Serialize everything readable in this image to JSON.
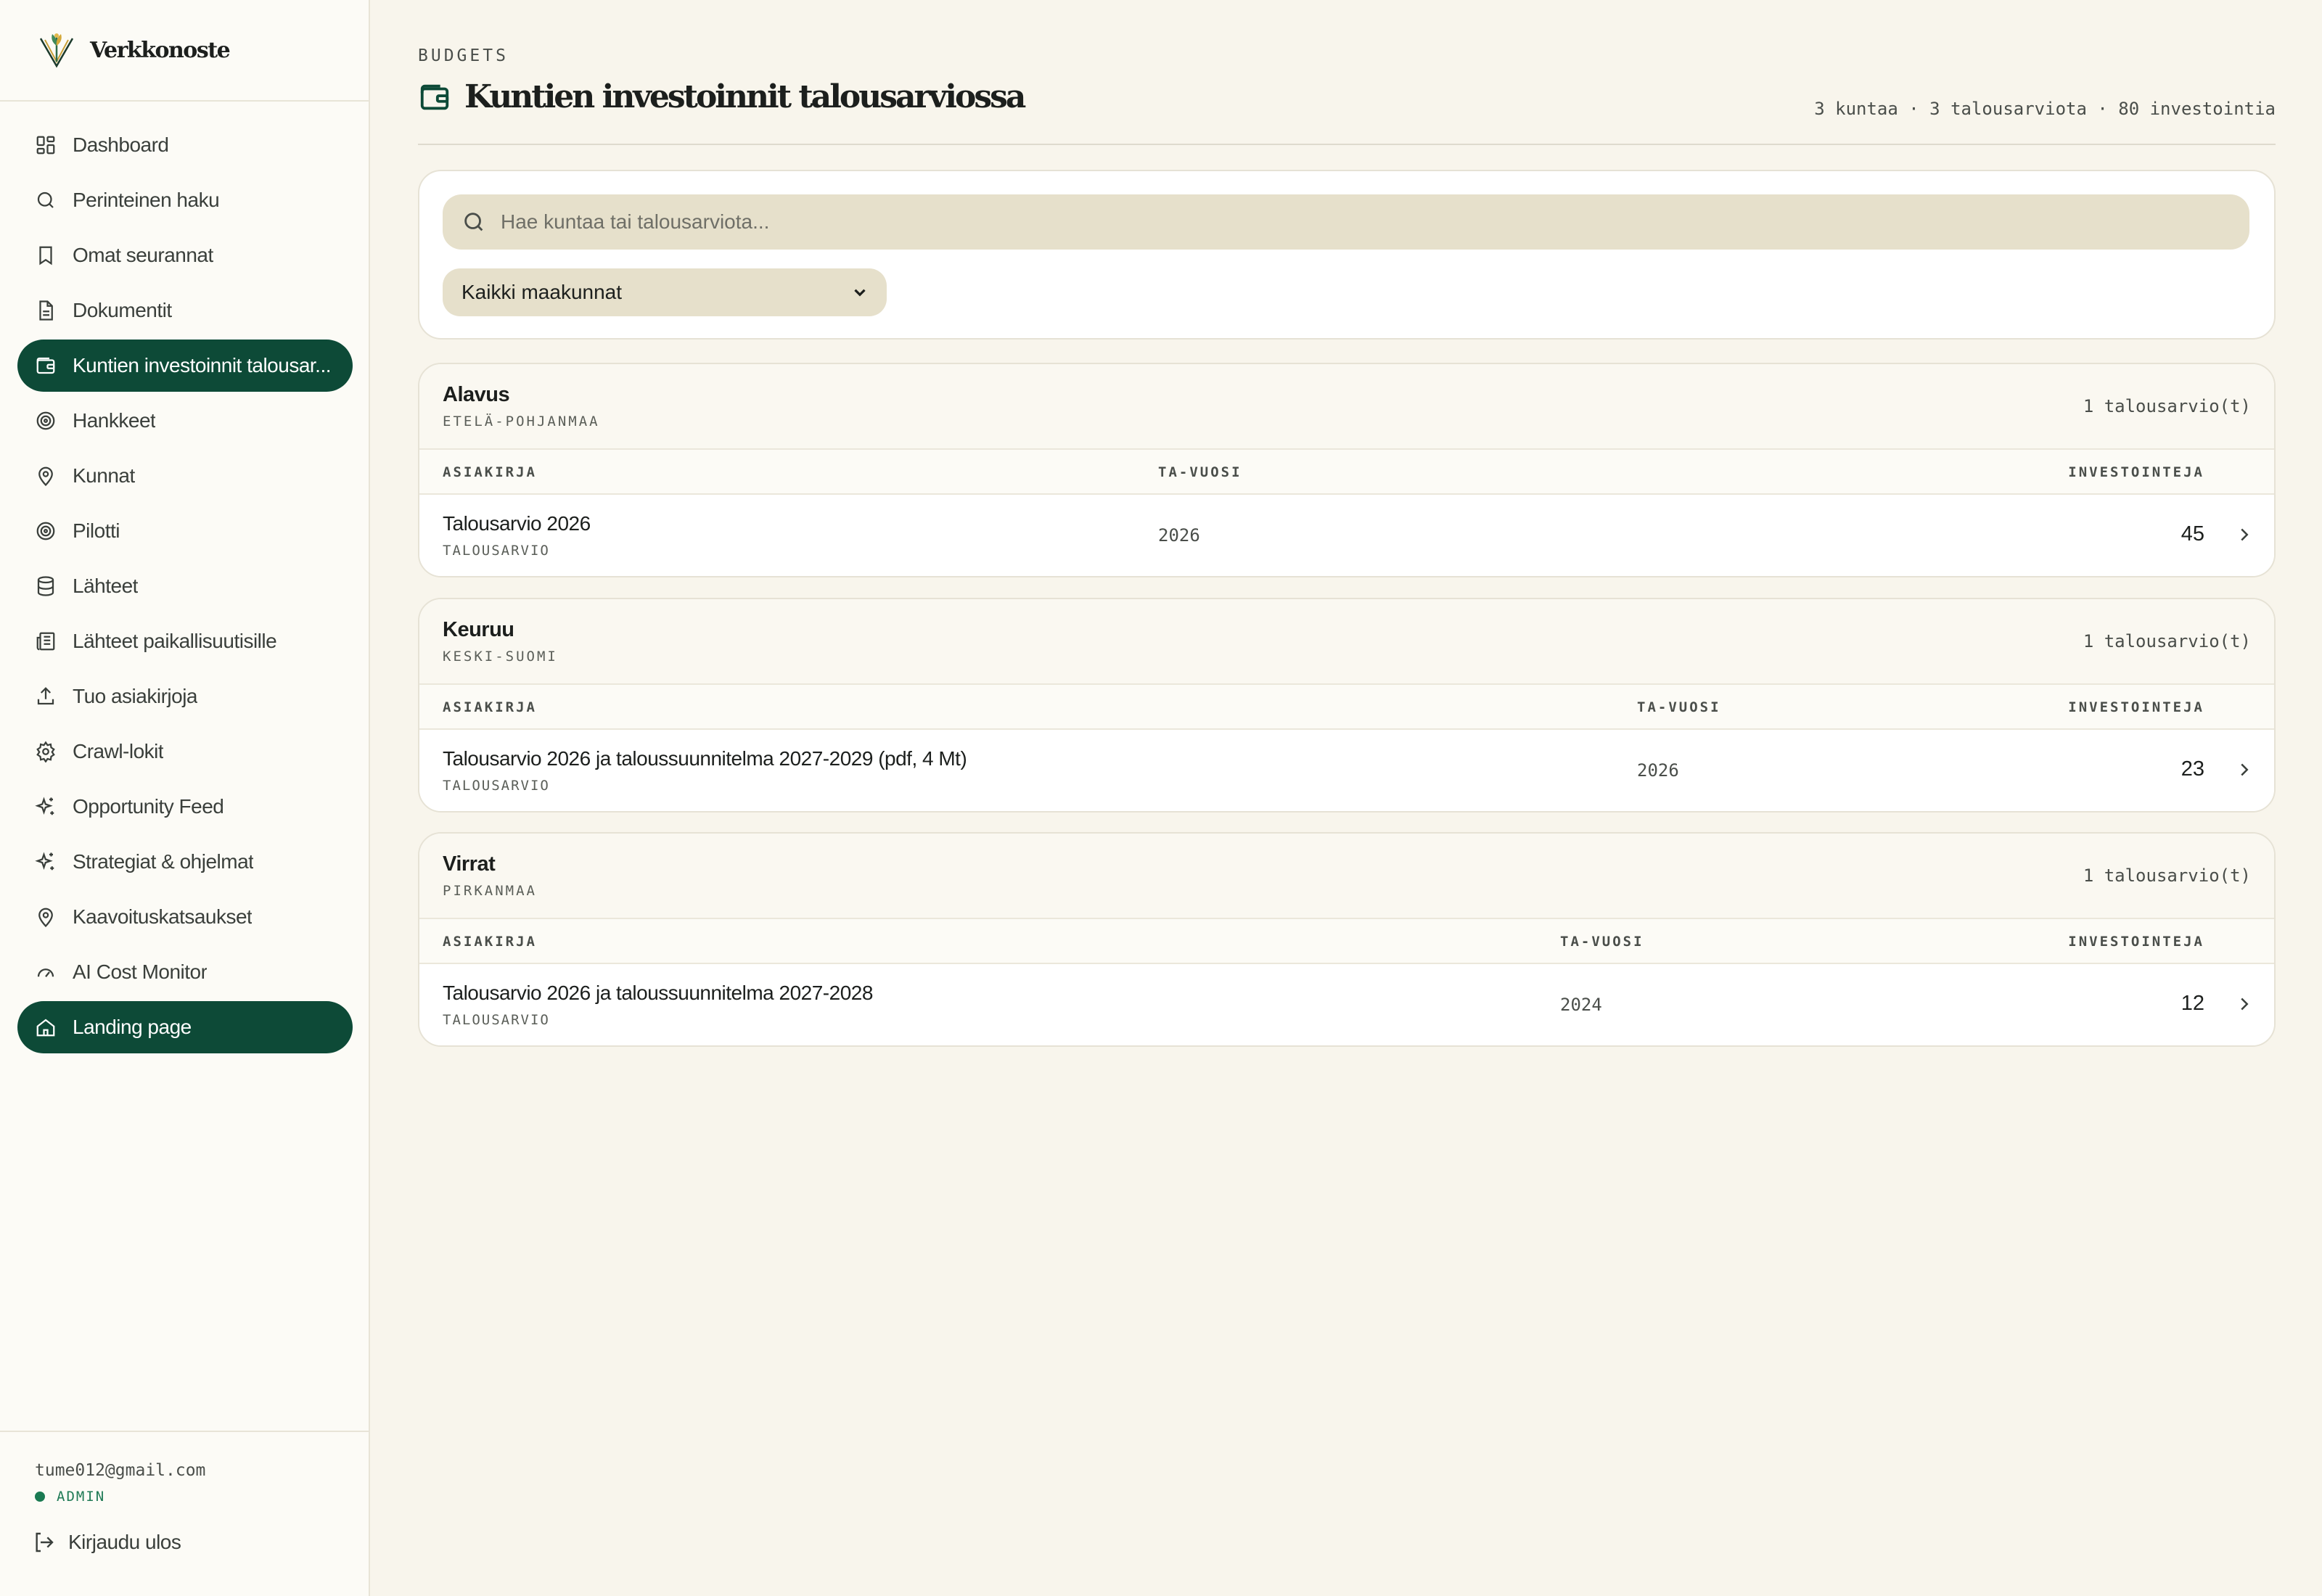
{
  "brand": {
    "name": "Verkkonoste"
  },
  "sidebar": {
    "items": [
      {
        "label": "Dashboard",
        "icon": "dashboard-icon"
      },
      {
        "label": "Perinteinen haku",
        "icon": "search-icon"
      },
      {
        "label": "Omat seurannat",
        "icon": "bookmark-icon"
      },
      {
        "label": "Dokumentit",
        "icon": "document-icon"
      },
      {
        "label": "Kuntien investoinnit talousar...",
        "icon": "wallet-icon",
        "active": true
      },
      {
        "label": "Hankkeet",
        "icon": "target-icon"
      },
      {
        "label": "Kunnat",
        "icon": "map-pin-icon"
      },
      {
        "label": "Pilotti",
        "icon": "target-icon"
      },
      {
        "label": "Lähteet",
        "icon": "database-icon"
      },
      {
        "label": "Lähteet paikallisuutisille",
        "icon": "newspaper-icon"
      },
      {
        "label": "Tuo asiakirjoja",
        "icon": "upload-icon"
      },
      {
        "label": "Crawl-lokit",
        "icon": "gear-icon"
      },
      {
        "label": "Opportunity Feed",
        "icon": "sparkles-icon"
      },
      {
        "label": "Strategiat & ohjelmat",
        "icon": "sparkles-icon"
      },
      {
        "label": "Kaavoituskatsaukset",
        "icon": "map-pin-icon"
      },
      {
        "label": "AI Cost Monitor",
        "icon": "gauge-icon"
      },
      {
        "label": "Landing page",
        "icon": "home-icon",
        "active": true
      }
    ]
  },
  "user": {
    "email": "tume012@gmail.com",
    "role": "ADMIN"
  },
  "logout": {
    "label": "Kirjaudu ulos"
  },
  "header": {
    "eyebrow": "BUDGETS",
    "title": "Kuntien investoinnit talousarviossa",
    "stats": "3 kuntaa · 3 talousarviota · 80 investointia"
  },
  "filters": {
    "search_placeholder": "Hae kuntaa tai talousarviota...",
    "region_select": "Kaikki maakunnat"
  },
  "table_headers": {
    "document": "ASIAKIRJA",
    "year": "TA-VUOSI",
    "investments": "INVESTOINTEJA"
  },
  "municipalities": [
    {
      "name": "Alavus",
      "region": "ETELÄ-POHJANMAA",
      "count": "1 talousarvio(t)",
      "rows": [
        {
          "title": "Talousarvio 2026",
          "type": "TALOUSARVIO",
          "year": "2026",
          "investments": "45"
        }
      ]
    },
    {
      "name": "Keuruu",
      "region": "KESKI-SUOMI",
      "count": "1 talousarvio(t)",
      "rows": [
        {
          "title": "Talousarvio 2026 ja taloussuunnitelma 2027-2029 (pdf, 4 Mt)",
          "type": "TALOUSARVIO",
          "year": "2026",
          "investments": "23"
        }
      ]
    },
    {
      "name": "Virrat",
      "region": "PIRKANMAA",
      "count": "1 talousarvio(t)",
      "rows": [
        {
          "title": "Talousarvio 2026 ja taloussuunnitelma 2027-2028",
          "type": "TALOUSARVIO",
          "year": "2024",
          "investments": "12"
        }
      ]
    }
  ],
  "colors": {
    "accent": "#0d4a37",
    "background": "#f8f5ec",
    "input": "#e6e0cb",
    "status_dot": "#1a7a52"
  }
}
